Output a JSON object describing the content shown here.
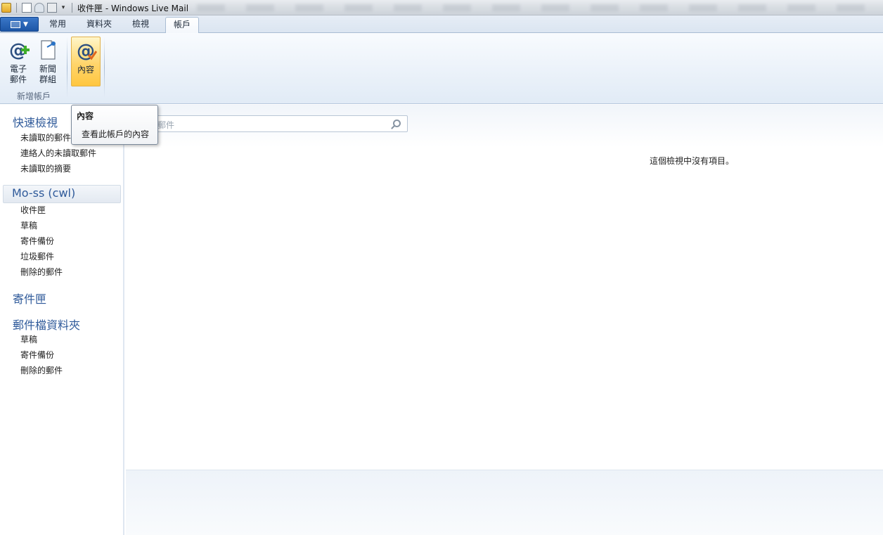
{
  "window": {
    "title": "收件匣 - Windows Live Mail"
  },
  "tabs": [
    {
      "label": "常用"
    },
    {
      "label": "資料夾"
    },
    {
      "label": "檢視"
    },
    {
      "label": "帳戶",
      "active": true
    }
  ],
  "ribbon": {
    "email_label_1": "電子",
    "email_label_2": "郵件",
    "newsgroup_label_1": "新聞",
    "newsgroup_label_2": "群組",
    "group_label": "新增帳戶",
    "properties_label": "內容"
  },
  "tooltip": {
    "title": "內容",
    "body": "查看此帳戶的內容"
  },
  "sidebar": {
    "quick_views_title": "快速檢視",
    "quick_views": [
      "未讀取的郵件",
      "連絡人的未讀取郵件",
      "未讀取的摘要"
    ],
    "account_title": "Mo-ss (cwl)",
    "account_folders": [
      "收件匣",
      "草稿",
      "寄件備份",
      "垃圾郵件",
      "刪除的郵件"
    ],
    "outbox_title": "寄件匣",
    "storage_title": "郵件檔資料夾",
    "storage_folders": [
      "草稿",
      "寄件備份",
      "刪除的郵件"
    ]
  },
  "search": {
    "placeholder": "郵件"
  },
  "message_list": {
    "empty_text": "這個檢視中沒有項目。"
  },
  "colors": {
    "accent": "#2f5a9a",
    "app_button": "#1d56a6",
    "highlight": "#ffd56b"
  },
  "icons": [
    "app-icon",
    "new-icon",
    "reply-icon",
    "print-icon",
    "add-email-icon",
    "newsgroup-icon",
    "properties-icon",
    "search-icon"
  ]
}
